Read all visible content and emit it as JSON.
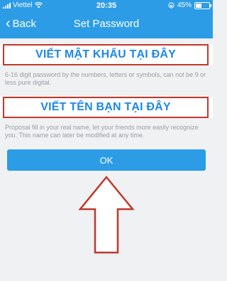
{
  "status_bar": {
    "carrier": "Viettel",
    "time": "20:35",
    "battery_text": "45%",
    "battery_level": 0.45
  },
  "nav": {
    "back_label": "Back",
    "title": "Set Password"
  },
  "password_field": {
    "overlay_text": "VIẾT MẬT KHẨU TẠI ĐÂY",
    "hint": "6-16 digit password by the numbers, letters or symbols, can not be 9 or less pure digital."
  },
  "name_field": {
    "overlay_text": "VIẾT TÊN BẠN TẠI ĐÂY",
    "hint": "Proposal fill in your real name, let your friends more easily recognize you. This name can later be modified at any time."
  },
  "ok_button": {
    "label": "OK"
  },
  "colors": {
    "header": "#2c9ce6",
    "annotation": "#c0392b",
    "overlay_text": "#1e88e5",
    "background": "#eff1f3"
  }
}
